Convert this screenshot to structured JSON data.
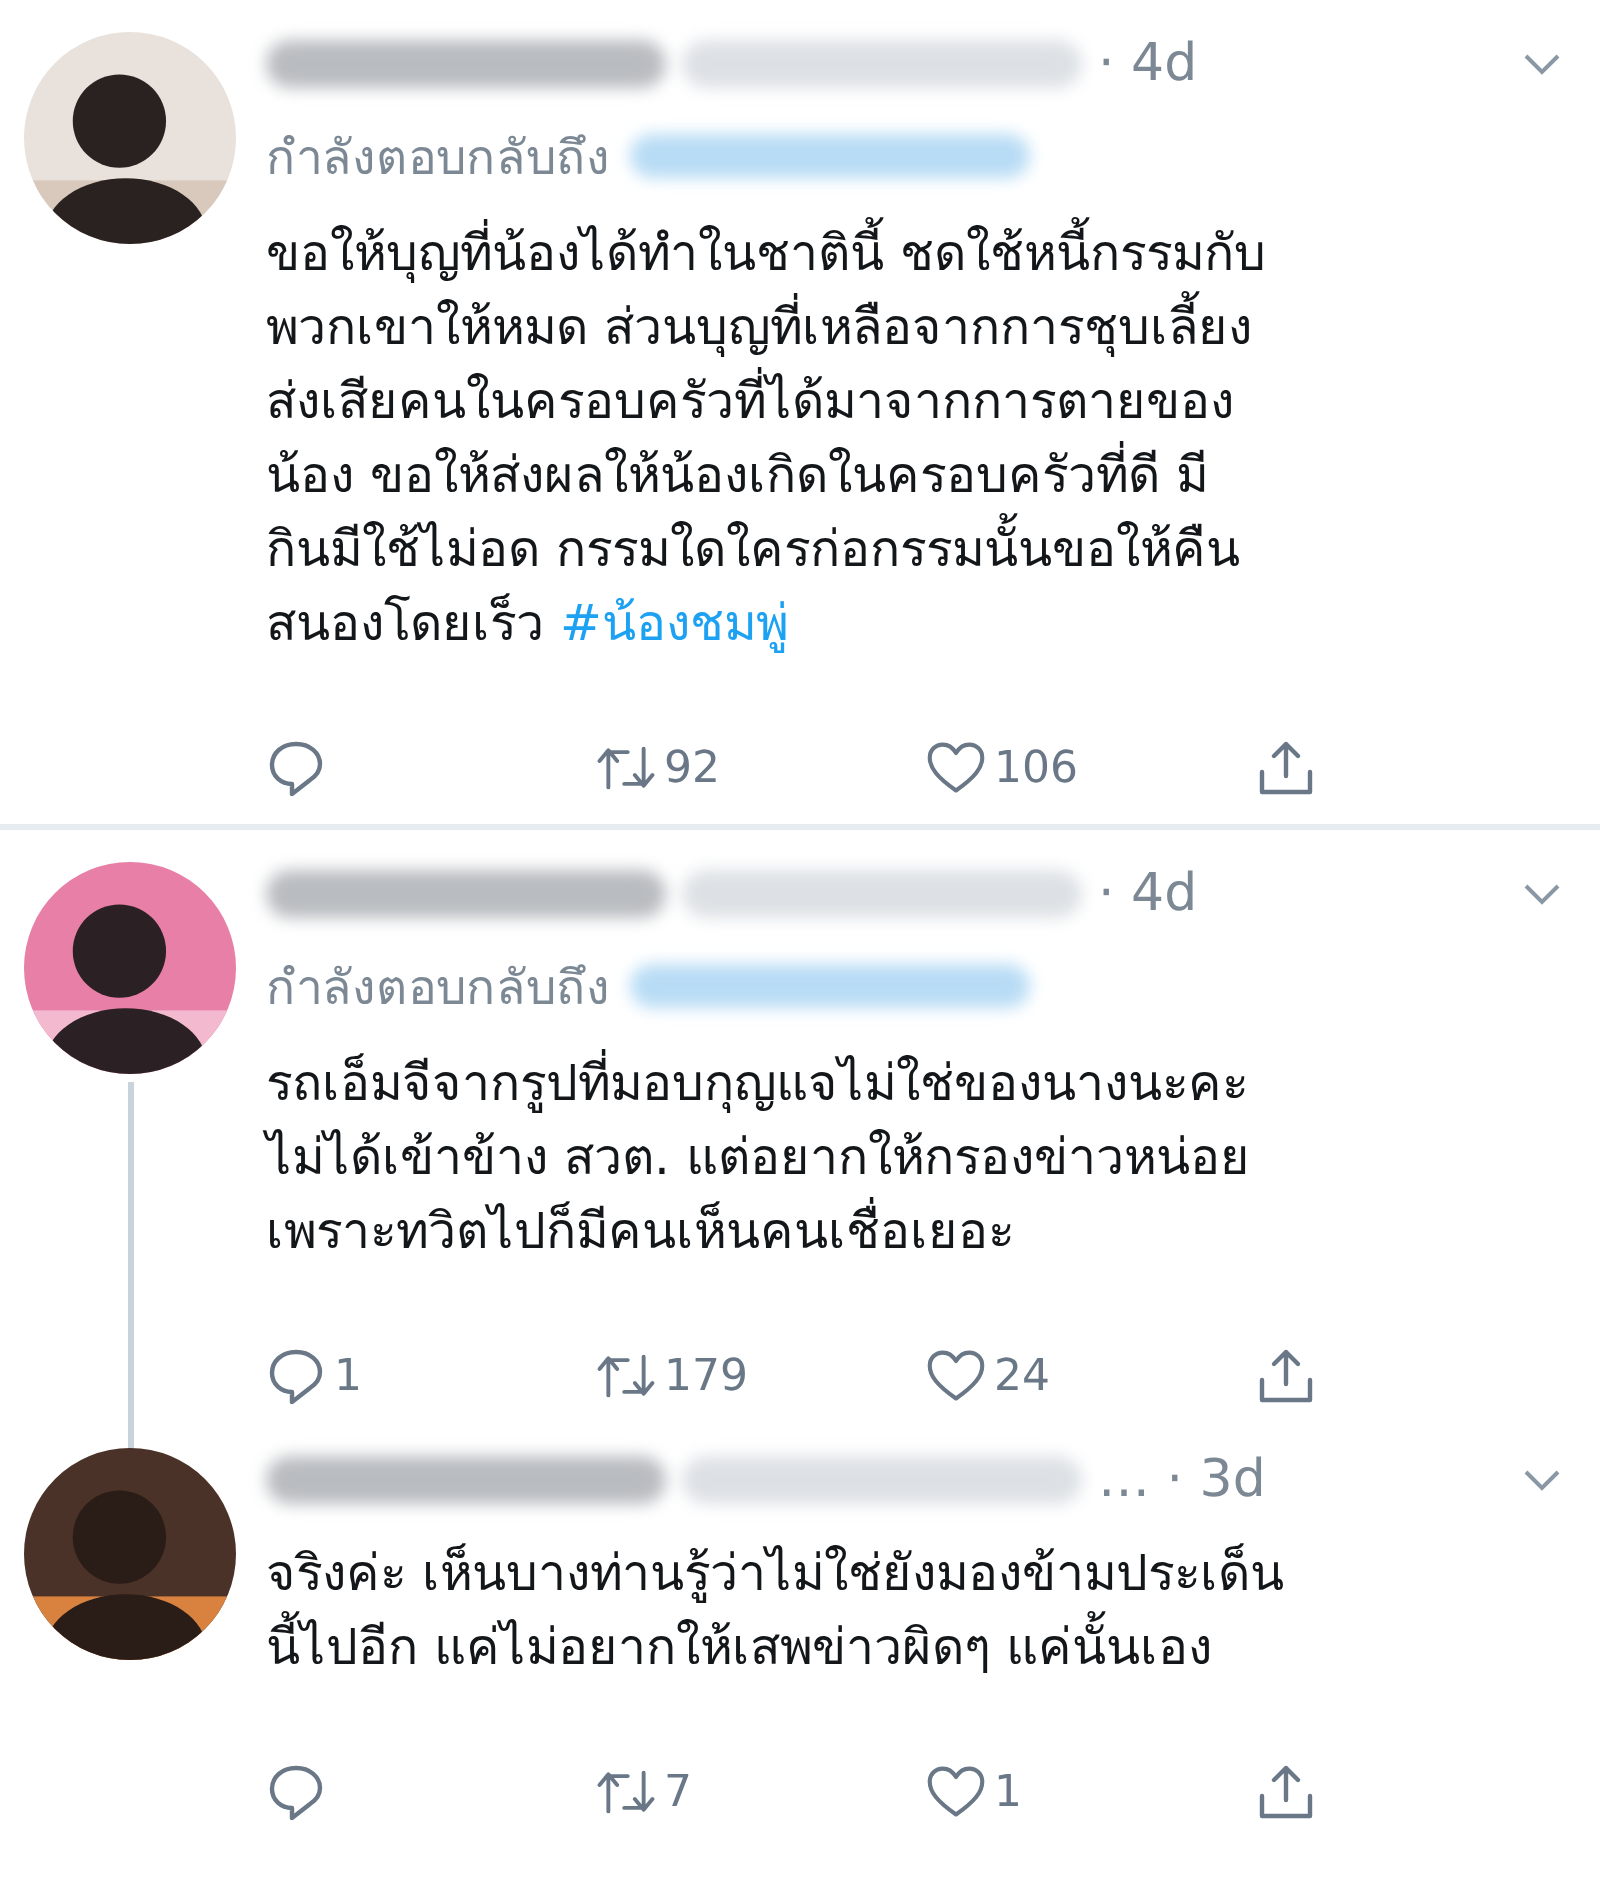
{
  "tweets": [
    {
      "time": "· 4d",
      "reply_to": "กำลังตอบกลับถึง",
      "lines": [
        "ขอให้บุญที่น้องได้ทำในชาตินี้ ชดใช้หนี้กรรมกับ",
        "พวกเขาให้หมด ส่วนบุญที่เหลือจากการชุบเลี้ยง",
        "ส่งเสียคนในครอบครัวที่ได้มาจากการตายของ",
        "น้อง ขอให้ส่งผลให้น้องเกิดในครอบครัวที่ดี  มี",
        "กินมีใช้ไม่อด กรรมใดใครก่อกรรมนั้นขอให้คืน",
        "สนองโดยเร็ว"
      ],
      "hashtag": "#น้องชมพู่",
      "retweets": "92",
      "likes": "106",
      "thread_continues": false
    },
    {
      "time": "· 4d",
      "reply_to": "กำลังตอบกลับถึง",
      "lines": [
        "รถเอ็มจีจากรูปที่มอบกุญแจไม่ใช่ของนางนะคะ",
        "ไม่ได้เข้าข้าง สวต. แต่อยากให้กรองข่าวหน่อย",
        "เพราะทวิตไปก็มีคนเห็นคนเชื่อเยอะ"
      ],
      "replies": "1",
      "retweets": "179",
      "likes": "24",
      "thread_continues": true
    },
    {
      "time": "… · 3d",
      "lines": [
        "จริงค่ะ เห็นบางท่านรู้ว่าไม่ใช่ยังมองข้ามประเด็น",
        "นี้ไปอีก แค่ไม่อยากให้เสพข่าวผิดๆ แค่นั้นเอง"
      ],
      "retweets": "7",
      "likes": "1",
      "thread_continues": false
    }
  ]
}
